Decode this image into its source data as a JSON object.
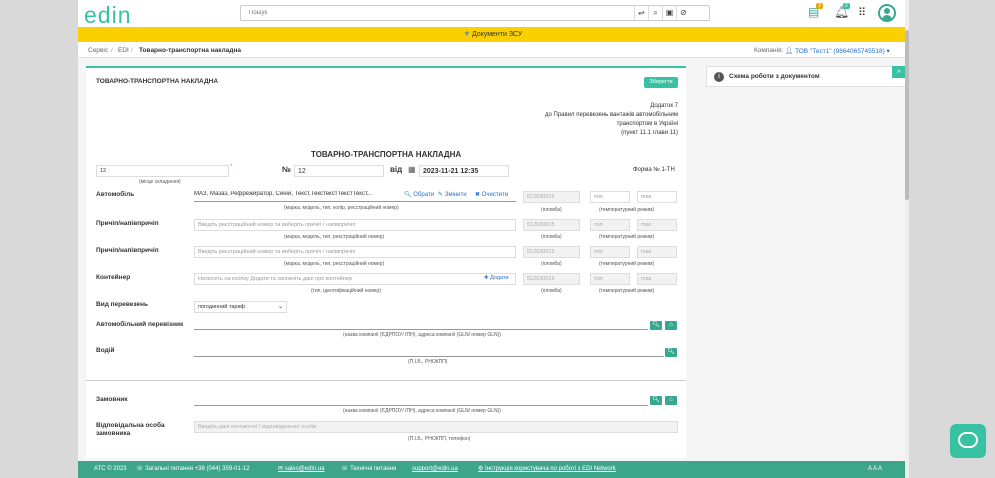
{
  "app": {
    "logo": "edin"
  },
  "search": {
    "placeholder": "Пошук"
  },
  "header": {
    "notif_badge_1": "3",
    "notif_badge_2": "2"
  },
  "banner": {
    "text": "Документи ЗСУ"
  },
  "breadcrumb": {
    "items": [
      "Сервіс",
      "EDI",
      "Товарно-транспортна накладна"
    ],
    "company_label": "Компанія:",
    "company_value": "ТОВ \"Тест1\" (9864065745518)"
  },
  "doc": {
    "panel_title": "ТОВАРНО-ТРАНСПОРТНА НАКЛАДНА",
    "save_label": "Зберегти",
    "appendix": [
      "Додаток 7",
      "до Правил перевезень вантажів автомобільним",
      "транспортом в Україні",
      "(пункт 11.1 глави 11)"
    ],
    "heading": "ТОВАРНО-ТРАНСПОРТНА НАКЛАДНА",
    "place_value": "12",
    "place_hint": "(місце складання)",
    "num_label": "№",
    "num_value": "12",
    "date_label": "від",
    "date_value": "2023-11-21 12:35",
    "form_label": "Форма № 1-ТН",
    "vehicle_label": "Автомобіль",
    "vehicle_value": "МАЗ, Мазаз, Рефрежиратор, Синій, Текст,ТекстекстТекстТекст...",
    "vehicle_actions": [
      "Обрати",
      "Змінити",
      "Очистити"
    ],
    "vehicle_hint": "(марка, модель, тип, колір, реєстраційний номер)",
    "seal_value": "512030015",
    "seal_hint": "(пломба)",
    "min_ph": "min",
    "max_ph": "max",
    "temp_hint": "(температурний режим)",
    "trailer_label": "Причіп/напівпричіп",
    "trailer_ph": "Введіть реєстраційний номер та виберіть причіп / напівпричіп",
    "trailer_hint": "(марка, модель, тип, реєстраційний номер)",
    "container_label": "Контейнер",
    "container_ph": "Натисніть на кнопку Додати та заповніть дані про контейнер",
    "container_add": "Додати",
    "container_hint": "(тип, ідентифікаційний номер)",
    "transport_label": "Вид перевезень",
    "transport_value": "погодинний тариф",
    "carrier_label": "Автомобільний перевізник",
    "carrier_hint": "(назва компанії (ЄДРПОУ/ ІПН), адреса компанії (GLN/ номер GLN))",
    "driver_label": "Водій",
    "driver_hint": "(П.І.Б., РНОКПП)",
    "customer_label": "Замовник",
    "customer_hint": "(назва компанії (ЄДРПОУ/ ІПН), адреса компанії (GLN/ номер GLN))",
    "resp_label": "Відповідальна особа замовника",
    "resp_ph": "Введіть дані контактної / відповідальної особи",
    "resp_hint": "(П.І.Б., РНОКПП, телефон)"
  },
  "side": {
    "title": "Схема роботи з документом"
  },
  "footer": {
    "copyright": "АТС © 2023",
    "general": "Загальні питання +38 (044) 359-01-12",
    "email": "sales@edin.ua",
    "tech_label": "Технічні питання",
    "tech_email": "support@edin.ua",
    "guide": "Інструкція користувача по роботі з EDI Network",
    "font_ctrl": "A A A"
  }
}
